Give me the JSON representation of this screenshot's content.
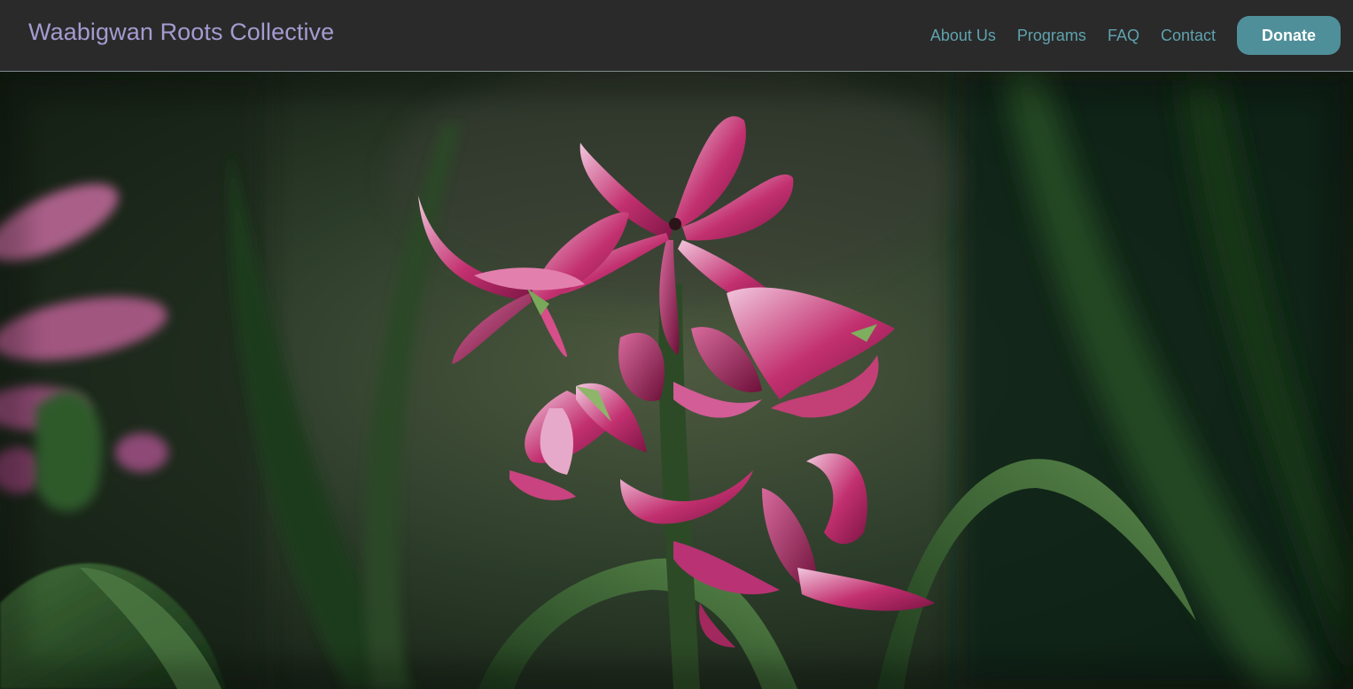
{
  "navbar": {
    "brand": "Waabigwan Roots Collective",
    "links": [
      {
        "label": "About Us"
      },
      {
        "label": "Programs"
      },
      {
        "label": "FAQ"
      },
      {
        "label": "Contact"
      }
    ],
    "donate_label": "Donate"
  },
  "hero": {
    "image_subject": "pink-hyacinth-flower-photo"
  },
  "colors": {
    "navbar_bg": "#2a2a2a",
    "brand_text": "#a59bd0",
    "nav_link": "#5fa3ae",
    "donate_bg": "#4f8f9a",
    "donate_text": "#ffffff"
  }
}
